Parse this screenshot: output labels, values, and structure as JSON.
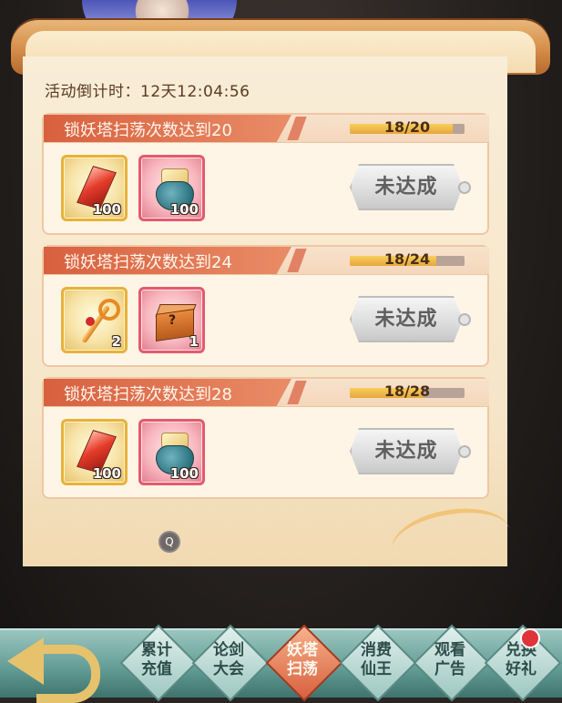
{
  "countdown": {
    "label": "活动倒计时：",
    "value": "12天12:04:56"
  },
  "tasks": [
    {
      "title": "锁妖塔扫荡次数达到20",
      "progress_text": "18/20",
      "progress": 0.9,
      "rewards": [
        {
          "icon": "red-gem-icon",
          "qty": "100",
          "frame": "gold"
        },
        {
          "icon": "treasure-pouch-icon",
          "qty": "100",
          "frame": "red"
        }
      ],
      "status": "未达成"
    },
    {
      "title": "锁妖塔扫荡次数达到24",
      "progress_text": "18/24",
      "progress": 0.75,
      "rewards": [
        {
          "icon": "key-icon",
          "qty": "2",
          "frame": "gold"
        },
        {
          "icon": "mystery-box-icon",
          "qty": "1",
          "frame": "red"
        }
      ],
      "status": "未达成"
    },
    {
      "title": "锁妖塔扫荡次数达到28",
      "progress_text": "18/28",
      "progress": 0.643,
      "rewards": [
        {
          "icon": "red-gem-icon",
          "qty": "100",
          "frame": "gold"
        },
        {
          "icon": "treasure-pouch-icon",
          "qty": "100",
          "frame": "red"
        }
      ],
      "status": "未达成"
    }
  ],
  "help_button": "Q",
  "nav": {
    "tabs": [
      {
        "line1": "累计",
        "line2": "充值",
        "active": false
      },
      {
        "line1": "论剑",
        "line2": "大会",
        "active": false
      },
      {
        "line1": "妖塔",
        "line2": "扫荡",
        "active": true
      },
      {
        "line1": "消费",
        "line2": "仙王",
        "active": false
      },
      {
        "line1": "观看",
        "line2": "广告",
        "active": false
      },
      {
        "line1": "兑换",
        "line2": "好礼",
        "active": false,
        "badge": true
      }
    ]
  },
  "colors": {
    "accent": "#d8603f",
    "progress": "#e7a63b",
    "status_disabled": "#dcdcdc"
  }
}
